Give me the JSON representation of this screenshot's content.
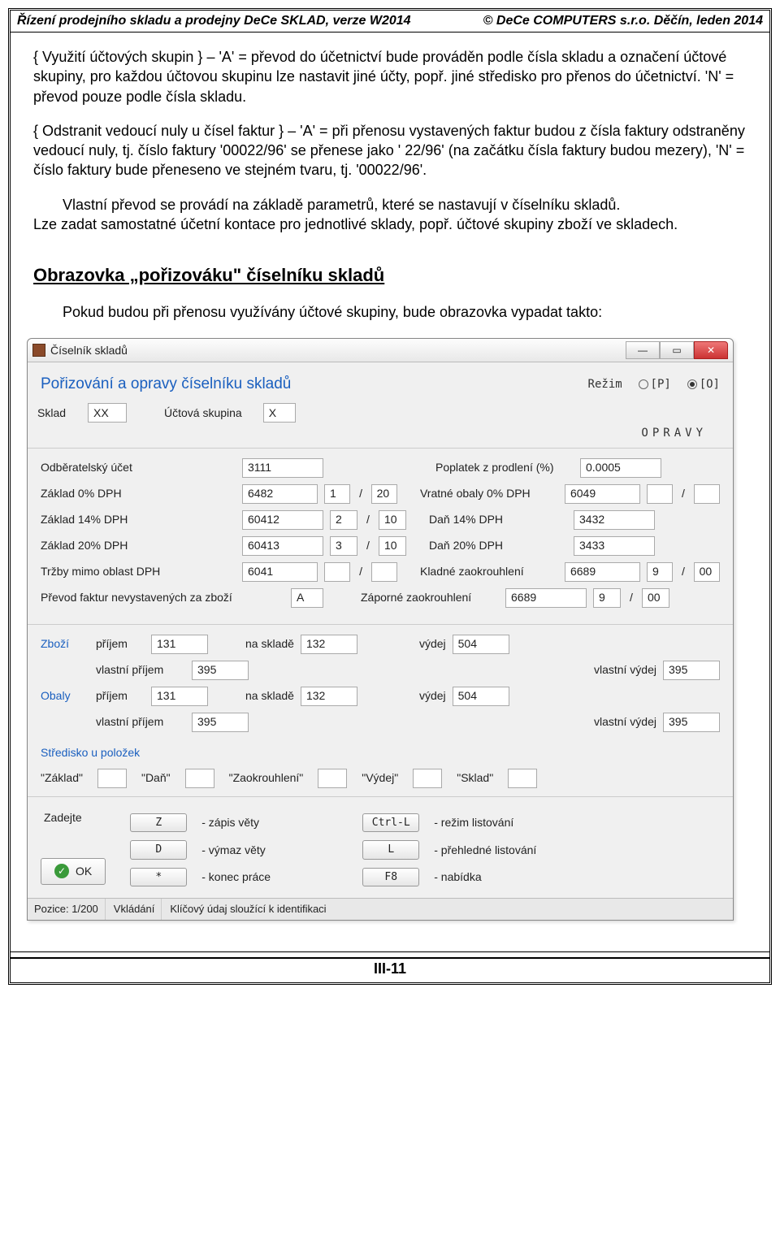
{
  "header": {
    "left": "Řízení prodejního skladu a prodejny DeCe SKLAD, verze W2014",
    "right": "© DeCe COMPUTERS s.r.o. Děčín, leden 2014"
  },
  "para1": "{ Využití účtových skupin } – 'A' = převod do účetnictví bude prováděn podle čísla skladu a označení účtové skupiny, pro každou účtovou skupinu lze nastavit jiné účty, popř. jiné středisko pro přenos do účetnictví. 'N' = převod pouze podle čísla skladu.",
  "para2": "{ Odstranit vedoucí nuly u čísel faktur } – 'A' = při přenosu vystavených faktur budou z čísla faktury odstraněny vedoucí nuly, tj. číslo faktury '00022/96' se přenese jako '    22/96' (na začátku čísla faktury budou mezery), 'N' = číslo faktury bude přeneseno ve stejném tvaru, tj. '00022/96'.",
  "para3a": "Vlastní převod se provádí na základě parametrů, které se nastavují v číselníku skladů.",
  "para3b": "Lze zadat samostatné účetní kontace pro jednotlivé sklady, popř. účtové skupiny zboží ve skladech.",
  "sectionTitle": "Obrazovka „pořizováku\" číselníku skladů",
  "subPara": "Pokud budou při přenosu využívány účtové skupiny, bude obrazovka vypadat takto:",
  "win": {
    "title": "Číselník skladů",
    "headerTitle": "Pořizování a opravy číselníku skladů",
    "rezimLabel": "Režim",
    "radioP": "[P]",
    "radioO": "[O]",
    "skladLabel": "Sklad",
    "skladValue": "XX",
    "ucSkupLabel": "Účtová skupina",
    "ucSkupValue": "X",
    "opravy": "OPRAVY",
    "rows": {
      "odbUcet": {
        "label": "Odběratelský účet",
        "v1": "3111",
        "rlabel": "Poplatek z prodlení (%)",
        "rv": "0.0005"
      },
      "z0": {
        "label": "Základ 0% DPH",
        "v1": "6482",
        "v2": "1",
        "v3": "20",
        "rlabel": "Vratné obaly 0% DPH",
        "rv": "6049"
      },
      "z14": {
        "label": "Základ 14% DPH",
        "v1": "60412",
        "v2": "2",
        "v3": "10",
        "rlabel": "Daň 14% DPH",
        "rv": "3432"
      },
      "z20": {
        "label": "Základ 20% DPH",
        "v1": "60413",
        "v2": "3",
        "v3": "10",
        "rlabel": "Daň 20% DPH",
        "rv": "3433"
      },
      "trzby": {
        "label": "Tržby mimo oblast DPH",
        "v1": "6041",
        "rlabel": "Kladné zaokrouhlení",
        "rv": "6689",
        "rv2": "9",
        "rv3": "00"
      },
      "prevod": {
        "label": "Převod faktur nevystavených za zboží",
        "v1": "A",
        "rlabel": "Záporné zaokrouhlení",
        "rv": "6689",
        "rv2": "9",
        "rv3": "00"
      }
    },
    "goods": {
      "zboziLabel": "Zboží",
      "obalyLabel": "Obaly",
      "prijemLabel": "příjem",
      "vlPrijemLabel": "vlastní příjem",
      "naSkladeLabel": "na skladě",
      "vydejLabel": "výdej",
      "vlVydejLabel": "vlastní výdej",
      "zbozi": {
        "prijem": "131",
        "naSklade": "132",
        "vydej": "504",
        "vlPrijem": "395",
        "vlVydej": "395"
      },
      "obaly": {
        "prijem": "131",
        "naSklade": "132",
        "vydej": "504",
        "vlPrijem": "395",
        "vlVydej": "395"
      }
    },
    "strediskoLabel": "Středisko u položek",
    "quotes": {
      "zaklad": "\"Základ\"",
      "dan": "\"Daň\"",
      "zaokr": "\"Zaokrouhlení\"",
      "vydej": "\"Výdej\"",
      "sklad": "\"Sklad\""
    },
    "zadejteLabel": "Zadejte",
    "okLabel": "OK",
    "keys": {
      "z": "Z",
      "zDesc": "- zápis věty",
      "d": "D",
      "dDesc": "- výmaz věty",
      "star": "*",
      "starDesc": "- konec práce",
      "ctrll": "Ctrl-L",
      "ctrllDesc": "- režim listování",
      "l": "L",
      "lDesc": "- přehledné listování",
      "f8": "F8",
      "f8Desc": "- nabídka"
    },
    "status": {
      "pozice": "Pozice: 1/200",
      "mode": "Vkládání",
      "hint": "Klíčový údaj sloužící k identifikaci"
    }
  },
  "footer": "III-11"
}
